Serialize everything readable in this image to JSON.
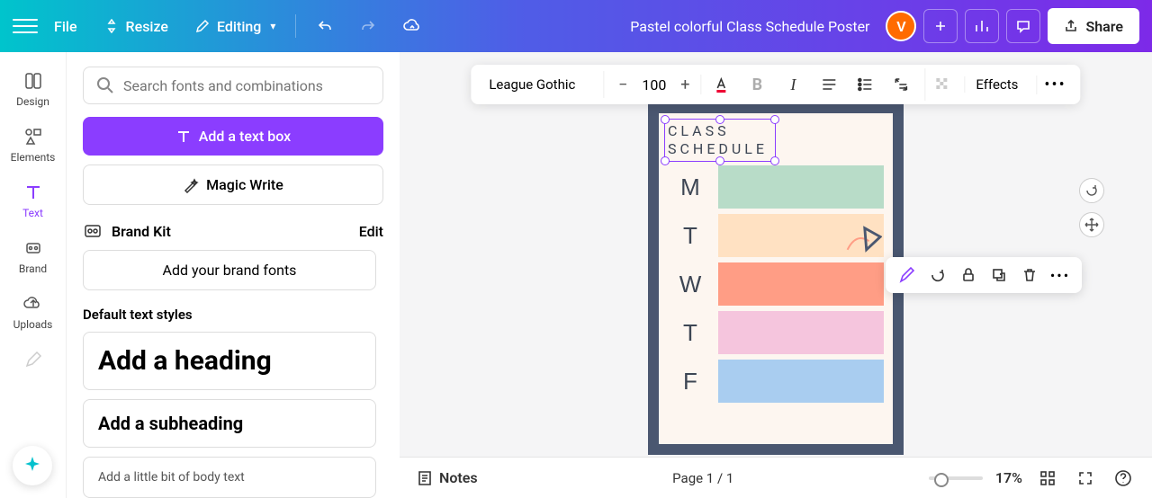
{
  "top": {
    "file": "File",
    "resize": "Resize",
    "editing": "Editing",
    "title": "Pastel colorful Class Schedule Poster",
    "avatar": "V",
    "share": "Share"
  },
  "siderail": {
    "design": "Design",
    "elements": "Elements",
    "text": "Text",
    "brand": "Brand",
    "uploads": "Uploads"
  },
  "panel": {
    "search_ph": "Search fonts and combinations",
    "add_text": "Add a text box",
    "magic": "Magic Write",
    "brand_kit": "Brand Kit",
    "edit": "Edit",
    "brand_add": "Add your brand fonts",
    "default_styles": "Default text styles",
    "heading": "Add a heading",
    "subheading": "Add a subheading",
    "body": "Add a little bit of body text"
  },
  "toolbar": {
    "font": "League Gothic",
    "size": "100",
    "effects": "Effects"
  },
  "poster": {
    "title_l1": "CLASS",
    "title_l2": "SCHEDULE",
    "days": [
      "M",
      "T",
      "W",
      "T",
      "F"
    ],
    "colors": [
      "c1",
      "c2",
      "c3",
      "c4",
      "c5"
    ]
  },
  "bottom": {
    "notes": "Notes",
    "page": "Page 1 / 1",
    "zoom": "17%"
  }
}
